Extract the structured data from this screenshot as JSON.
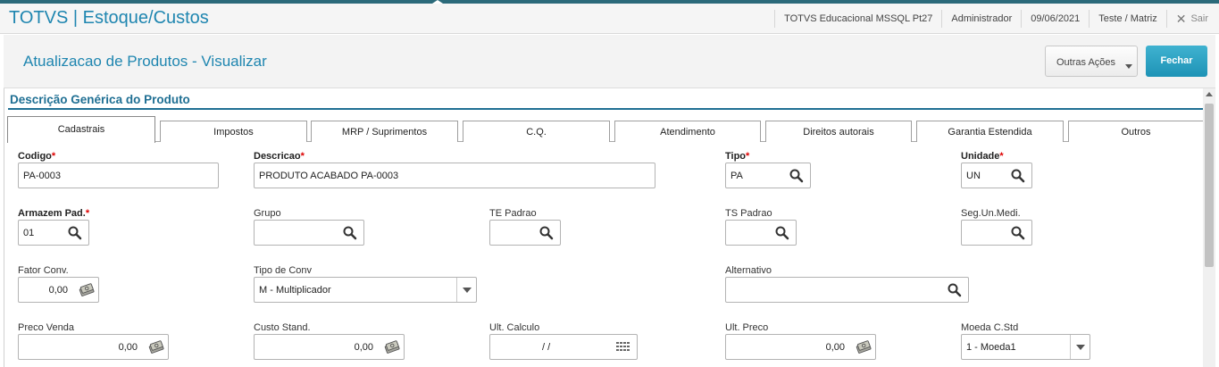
{
  "app": {
    "title": "TOTVS | Estoque/Custos",
    "environment": "TOTVS Educacional MSSQL Pt27",
    "user": "Administrador",
    "date": "09/06/2021",
    "branch": "Teste / Matriz",
    "exit_label": "Sair"
  },
  "page": {
    "title": "Atualizacao de Produtos - Visualizar",
    "more_actions_label": "Outras Ações",
    "close_label": "Fechar"
  },
  "section": {
    "title": "Descrição Genérica do Produto"
  },
  "tabs": [
    "Cadastrais",
    "Impostos",
    "MRP / Suprimentos",
    "C.Q.",
    "Atendimento",
    "Direitos autorais",
    "Garantia Estendida",
    "Outros"
  ],
  "fields": {
    "codigo": {
      "label": "Codigo",
      "value": "PA-0003"
    },
    "descricao": {
      "label": "Descricao",
      "value": "PRODUTO ACABADO PA-0003"
    },
    "tipo": {
      "label": "Tipo",
      "value": "PA"
    },
    "unidade": {
      "label": "Unidade",
      "value": "UN"
    },
    "armazem": {
      "label": "Armazem Pad.",
      "value": "01"
    },
    "grupo": {
      "label": "Grupo",
      "value": ""
    },
    "te_padrao": {
      "label": "TE Padrao",
      "value": ""
    },
    "ts_padrao": {
      "label": "TS Padrao",
      "value": ""
    },
    "seg_un": {
      "label": "Seg.Un.Medi.",
      "value": ""
    },
    "fator_conv": {
      "label": "Fator Conv.",
      "value": "0,00"
    },
    "tipo_conv": {
      "label": "Tipo de Conv",
      "value": "M - Multiplicador"
    },
    "alternativo": {
      "label": "Alternativo",
      "value": ""
    },
    "preco_venda": {
      "label": "Preco Venda",
      "value": "0,00"
    },
    "custo_stand": {
      "label": "Custo Stand.",
      "value": "0,00"
    },
    "ult_calculo": {
      "label": "Ult. Calculo",
      "value": "/  /"
    },
    "ult_preco": {
      "label": "Ult. Preco",
      "value": "0,00"
    },
    "moeda_cstd": {
      "label": "Moeda C.Std",
      "value": "1 - Moeda1"
    }
  },
  "colors": {
    "accent": "#1f86b0",
    "section": "#1f6f93",
    "required": "#dd0000",
    "primary_button": "#22a0c4"
  },
  "icons": {
    "lookup": "search-icon",
    "currency": "money-icon",
    "date": "calendar-icon",
    "dropdown": "chevron-down-icon",
    "close": "close-icon"
  }
}
